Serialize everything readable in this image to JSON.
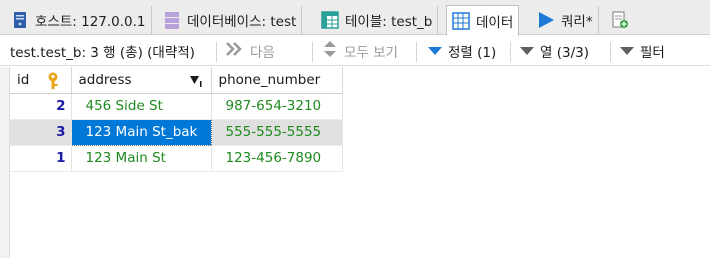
{
  "tabs": [
    {
      "label": "호스트: 127.0.0.1",
      "icon": "host-icon"
    },
    {
      "label": "데이터베이스: test",
      "icon": "database-icon"
    },
    {
      "label": "테이블: test_b",
      "icon": "table-icon"
    },
    {
      "label": "데이터",
      "icon": "data-grid-icon",
      "active": true
    },
    {
      "label": "쿼리*",
      "icon": "query-run-icon"
    }
  ],
  "toolbar": {
    "summary": "test.test_b: 3 행 (총) (대략적)",
    "next": "다음",
    "show_all": "모두 보기",
    "sort": "정렬 (1)",
    "columns": "열 (3/3)",
    "filter": "필터"
  },
  "grid": {
    "columns": [
      "id",
      "address",
      "phone_number"
    ],
    "rows": [
      {
        "id": "2",
        "address": "456 Side St",
        "phone_number": "987-654-3210"
      },
      {
        "id": "3",
        "address": "123 Main St_bak",
        "phone_number": "555-555-5555",
        "selected": true
      },
      {
        "id": "1",
        "address": "123 Main St",
        "phone_number": "123-456-7890"
      }
    ]
  },
  "colors": {
    "accent": "#0078d7",
    "value_text": "#1f8a1f",
    "id_text": "#1a1aa8",
    "selected_row": "#e0e0e0"
  }
}
